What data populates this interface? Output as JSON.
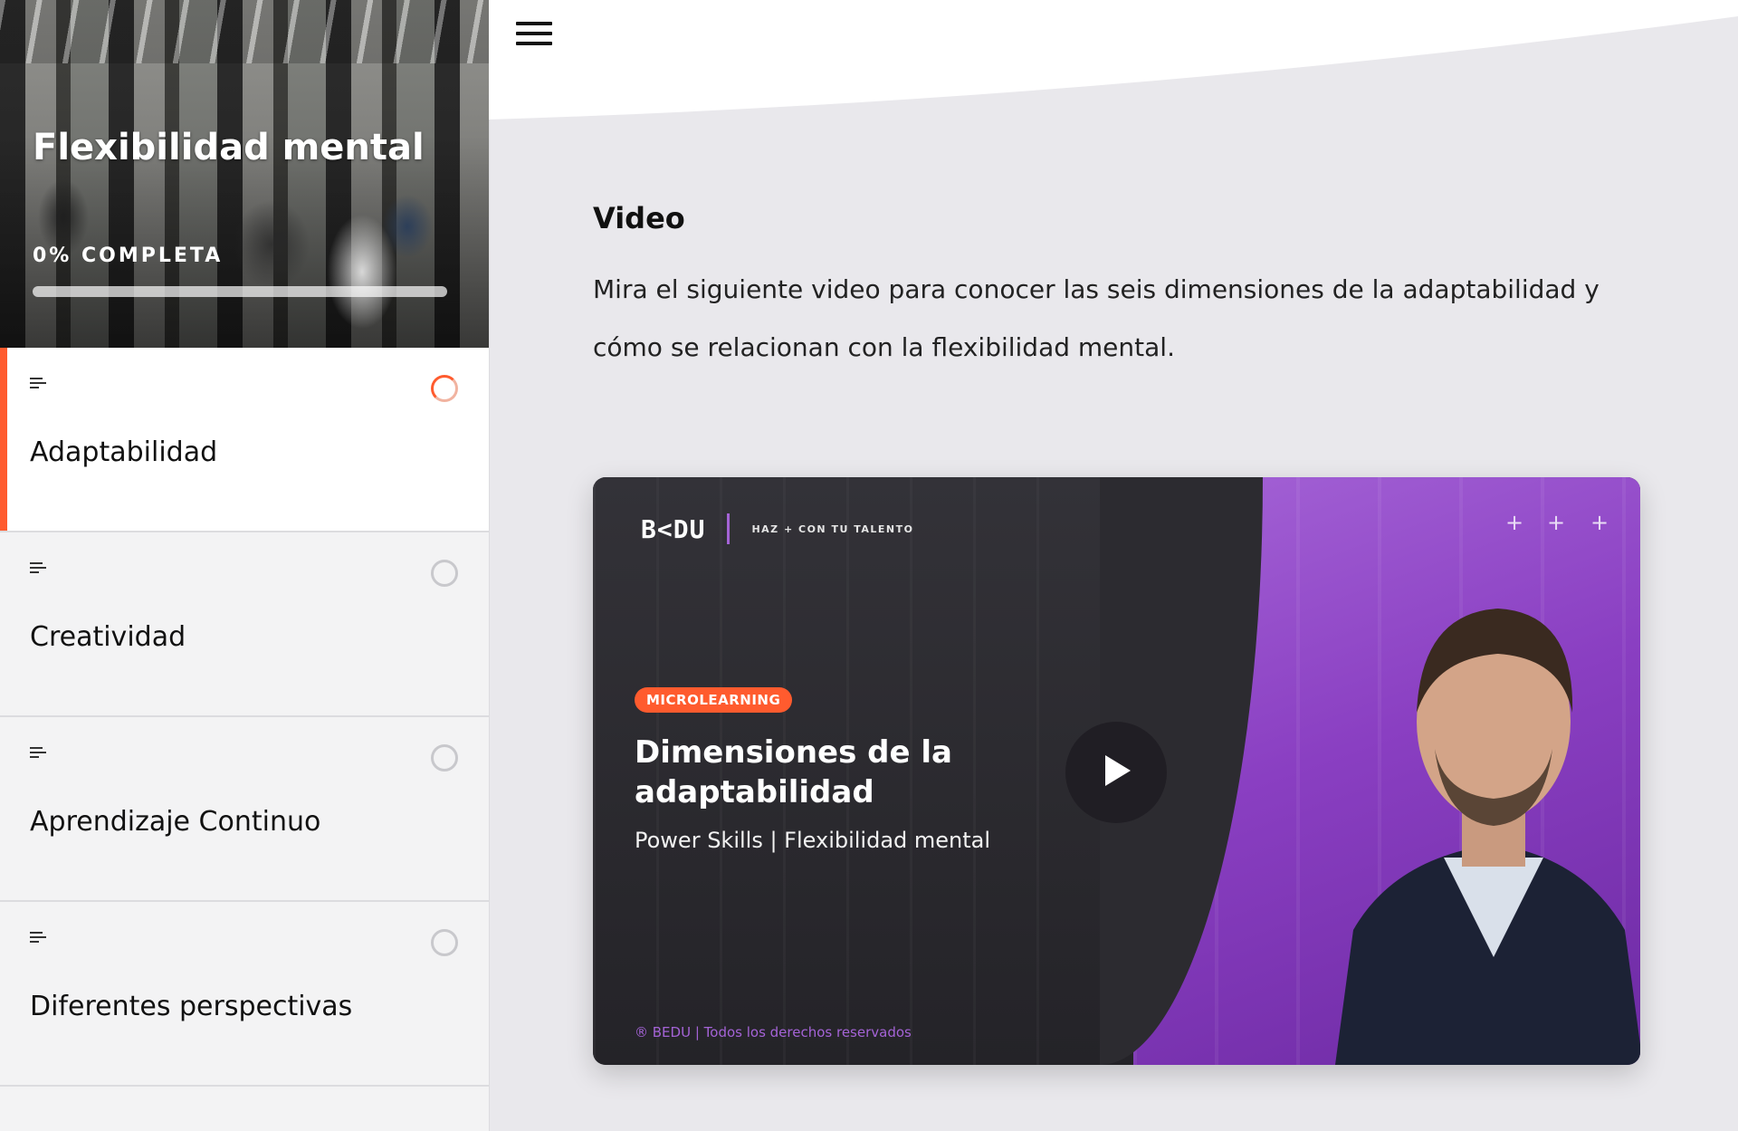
{
  "course": {
    "title": "Flexibilidad mental",
    "progress_label": "0% COMPLETA",
    "progress_value": 0
  },
  "lessons": [
    {
      "title": "Adaptabilidad",
      "active": true,
      "status": "in-progress"
    },
    {
      "title": "Creatividad",
      "active": false,
      "status": "not-started"
    },
    {
      "title": "Aprendizaje Continuo",
      "active": false,
      "status": "not-started"
    },
    {
      "title": "Diferentes perspectivas",
      "active": false,
      "status": "not-started"
    }
  ],
  "content": {
    "heading": "Video",
    "description": "Mira el siguiente video para conocer las seis dimensiones de la adaptabilidad y cómo se relacionan con la flexibilidad mental."
  },
  "video": {
    "brand": "B<DU",
    "tagline": "HAZ + CON TU TALENTO",
    "badge": "MICROLEARNING",
    "title": "Dimensiones de la adaptabilidad",
    "subtitle": "Power Skills | Flexibilidad mental",
    "copyright": "® BEDU | Todos los derechos reservados"
  },
  "colors": {
    "accent": "#ff5b2e",
    "purple": "#a463d6",
    "background": "#e9e8ec"
  },
  "icons": [
    "menu-icon",
    "text-lesson-icon",
    "progress-ring-icon",
    "play-icon"
  ]
}
